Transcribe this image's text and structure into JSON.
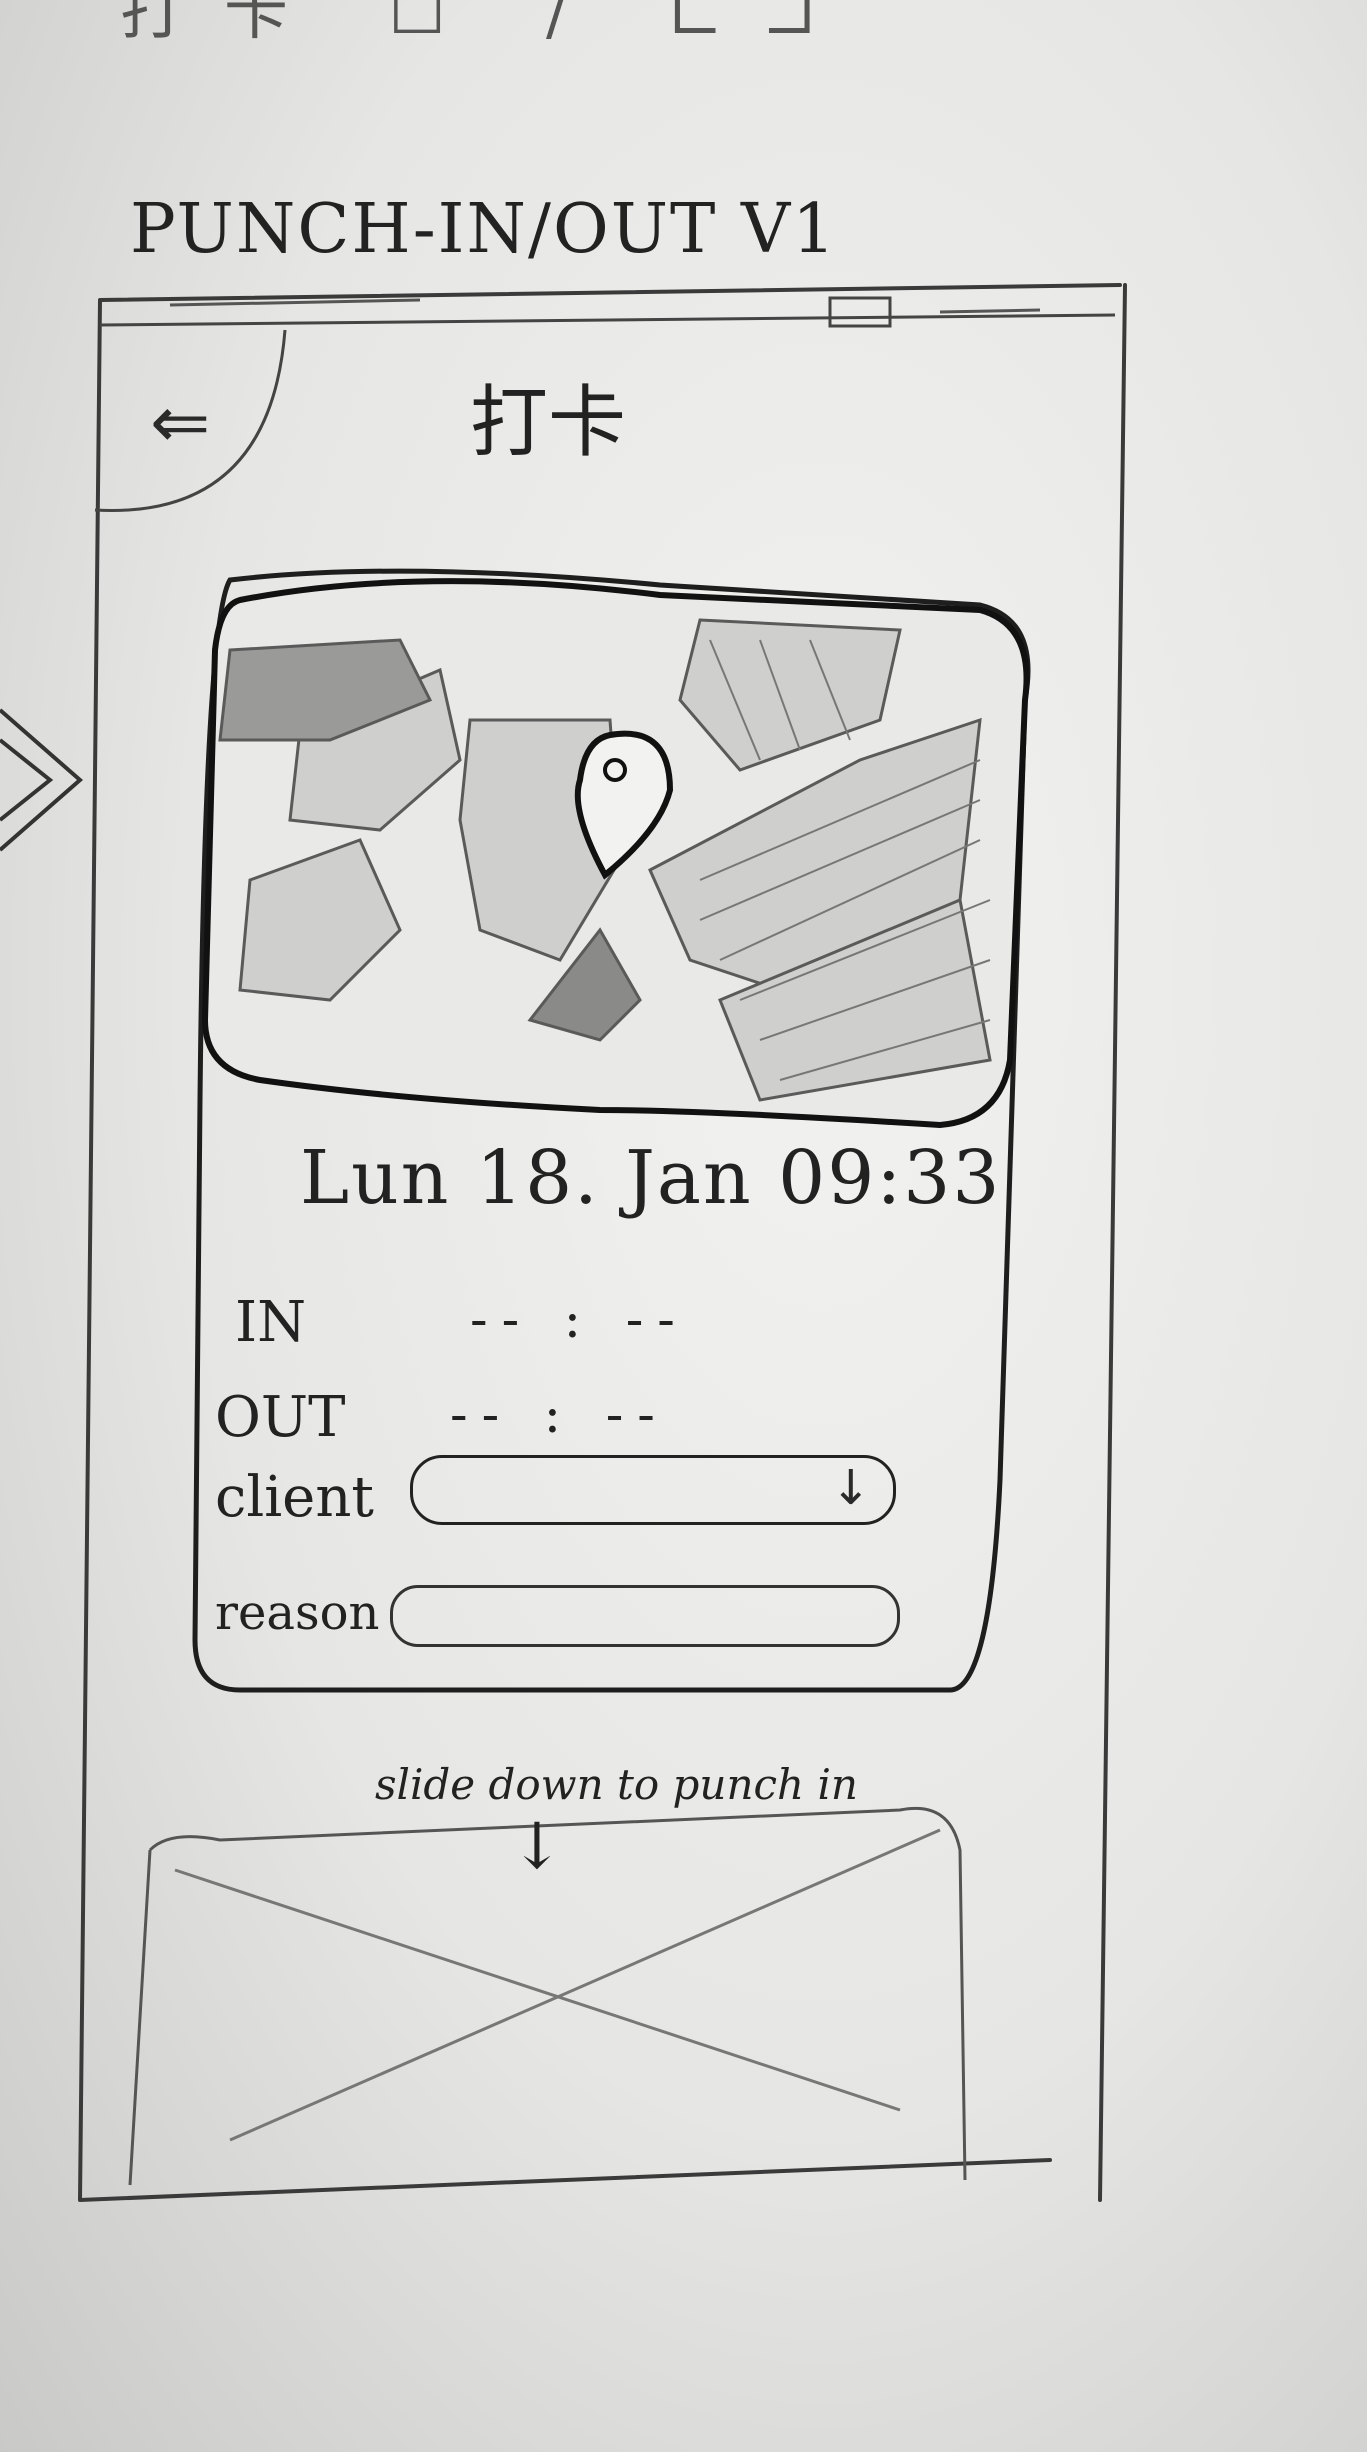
{
  "top_strip": {
    "text": "打卡 ☐ / ⊏⊐"
  },
  "sketch": {
    "title": "PUNCH-IN/OUT V1"
  },
  "header": {
    "title": "打卡",
    "back_icon": "back-arrow-icon"
  },
  "punch": {
    "datetime": "Lun 18. Jan 09:33",
    "in_label": "IN",
    "in_value": "-- : --",
    "out_label": "OUT",
    "out_value": "-- : --",
    "client_label": "client",
    "reason_label": "reason"
  },
  "slide": {
    "hint": "slide down to punch in",
    "arrow": "↓"
  }
}
